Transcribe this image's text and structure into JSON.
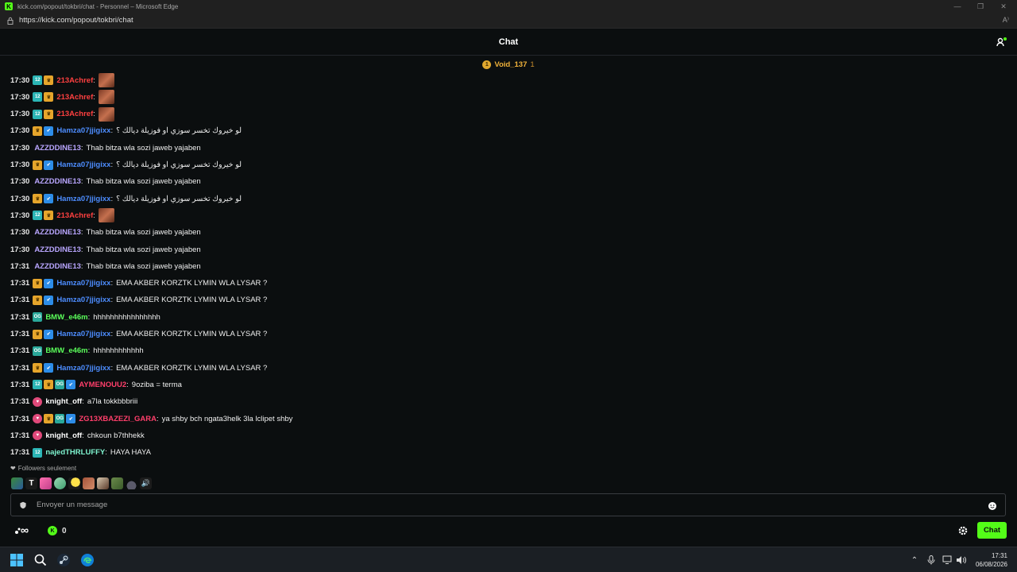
{
  "window": {
    "title": "kick.com/popout/tokbri/chat - Personnel – Microsoft Edge",
    "url": "https://kick.com/popout/tokbri/chat",
    "reader_label": "A⁾"
  },
  "header": {
    "title": "Chat"
  },
  "pinned": {
    "coin_label": "1",
    "name": "Void_137",
    "count": "1"
  },
  "colors": {
    "accent": "#53fc18",
    "user_red": "#ff3c3c",
    "user_blue": "#4d8dff",
    "user_purple": "#b9a6ff",
    "user_green": "#5bff5b",
    "user_pink": "#ff3f6b",
    "user_white": "#ffffff",
    "user_mint": "#7ff5d0"
  },
  "messages": [
    {
      "time": "17:30",
      "user": "213Achref",
      "color": "#ff4040",
      "text": "",
      "emote": true
    },
    {
      "time": "17:30",
      "user": "213Achref",
      "color": "#ff4040",
      "text": "",
      "emote": true
    },
    {
      "time": "17:30",
      "user": "213Achref",
      "color": "#ff4040",
      "text": "",
      "emote": true
    },
    {
      "time": "17:30",
      "user": "Hamza07jjigixx",
      "color": "#4d8dff",
      "text": "لو خيروك تخسر سوزي او فوزيلة ديالك ؟",
      "emote": false
    },
    {
      "time": "17:30",
      "user": "AZZDDINE13",
      "color": "#b9a6ff",
      "text": "Thab bitza wla sozi jaweb yajaben",
      "emote": false
    },
    {
      "time": "17:30",
      "user": "Hamza07jjigixx",
      "color": "#4d8dff",
      "text": "لو خيروك تخسر سوزي او فوزيلة ديالك ؟",
      "emote": false
    },
    {
      "time": "17:30",
      "user": "AZZDDINE13",
      "color": "#b9a6ff",
      "text": "Thab bitza wla sozi jaweb yajaben",
      "emote": false
    },
    {
      "time": "17:30",
      "user": "Hamza07jjigixx",
      "color": "#4d8dff",
      "text": "لو خيروك تخسر سوزي او فوزيلة ديالك ؟",
      "emote": false
    },
    {
      "time": "17:30",
      "user": "213Achref",
      "color": "#ff4040",
      "text": "",
      "emote": true
    },
    {
      "time": "17:30",
      "user": "AZZDDINE13",
      "color": "#b9a6ff",
      "text": "Thab bitza wla sozi jaweb yajaben",
      "emote": false
    },
    {
      "time": "17:30",
      "user": "AZZDDINE13",
      "color": "#b9a6ff",
      "text": "Thab bitza wla sozi jaweb yajaben",
      "emote": false
    },
    {
      "time": "17:31",
      "user": "AZZDDINE13",
      "color": "#b9a6ff",
      "text": "Thab bitza wla sozi jaweb yajaben",
      "emote": false
    },
    {
      "time": "17:31",
      "user": "Hamza07jjigixx",
      "color": "#4d8dff",
      "text": "EMA AKBER KORZTK LYMIN WLA LYSAR ?",
      "emote": false
    },
    {
      "time": "17:31",
      "user": "Hamza07jjigixx",
      "color": "#4d8dff",
      "text": "EMA AKBER KORZTK LYMIN WLA LYSAR ?",
      "emote": false
    },
    {
      "time": "17:31",
      "user": "BMW_e46m",
      "color": "#5bff5b",
      "text": "hhhhhhhhhhhhhhhh",
      "emote": false
    },
    {
      "time": "17:31",
      "user": "Hamza07jjigixx",
      "color": "#4d8dff",
      "text": "EMA AKBER KORZTK LYMIN WLA LYSAR ?",
      "emote": false
    },
    {
      "time": "17:31",
      "user": "BMW_e46m",
      "color": "#5bff5b",
      "text": "hhhhhhhhhhhh",
      "emote": false
    },
    {
      "time": "17:31",
      "user": "Hamza07jjigixx",
      "color": "#4d8dff",
      "text": "EMA AKBER KORZTK LYMIN WLA LYSAR ?",
      "emote": false
    },
    {
      "time": "17:31",
      "user": "AYMENOUU2",
      "color": "#ff3f6b",
      "text": "9oziba = terma",
      "emote": false
    },
    {
      "time": "17:31",
      "user": "knight_off",
      "color": "#ffffff",
      "text": "a7la tokkbbbriii",
      "emote": false
    },
    {
      "time": "17:31",
      "user": "ZG13XBAZEZI_GARA",
      "color": "#ff3f6b",
      "text": "ya shby bch ngata3helk 3la lclipet shby",
      "emote": false
    },
    {
      "time": "17:31",
      "user": "knight_off",
      "color": "#ffffff",
      "text": "chkoun b7thhekk",
      "emote": false
    },
    {
      "time": "17:31",
      "user": "najedTHRLUFFY",
      "color": "#7ff5d0",
      "text": "HAYA HAYA",
      "emote": false
    }
  ],
  "followers_notice": "Followers seulement",
  "input": {
    "placeholder": "Envoyer un message"
  },
  "bottom": {
    "points": "0",
    "chat_label": "Chat"
  },
  "taskbar": {
    "time": "17:31",
    "date": "06/08/2026"
  }
}
